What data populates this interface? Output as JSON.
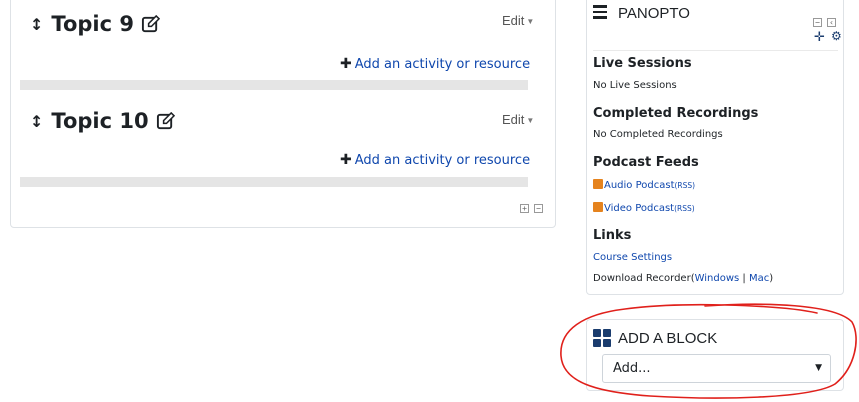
{
  "topics": [
    {
      "title": "Topic 9",
      "edit_label": "Edit",
      "add_label": "Add an activity or resource"
    },
    {
      "title": "Topic 10",
      "edit_label": "Edit",
      "add_label": "Add an activity or resource"
    }
  ],
  "panopto": {
    "title": "PANOPTO",
    "live_sessions_heading": "Live Sessions",
    "live_sessions_text": "No Live Sessions",
    "completed_heading": "Completed Recordings",
    "completed_text": "No Completed Recordings",
    "podcast_heading": "Podcast Feeds",
    "audio_podcast": "Audio Podcast",
    "video_podcast": "Video Podcast",
    "rss_label": "(RSS)",
    "links_heading": "Links",
    "course_settings": "Course Settings",
    "download_recorder": "Download Recorder",
    "windows_label": "Windows",
    "mac_label": "Mac",
    "paren_open": "(",
    "separator": " | ",
    "paren_close": ")"
  },
  "add_block": {
    "title": "ADD A BLOCK",
    "select_value": "Add..."
  },
  "colors": {
    "link": "#0f47ad",
    "annotation": "#e0201b",
    "rss": "#e5831e",
    "block_icon": "#1a3c6e"
  },
  "icons": [
    "move-icon",
    "pencil-edit-icon",
    "plus-icon",
    "caret-down-icon",
    "hamburger-icon",
    "dock-icon",
    "move-block-icon",
    "gear-icon",
    "rss-icon",
    "grid-block-icon",
    "select-caret-icon"
  ]
}
